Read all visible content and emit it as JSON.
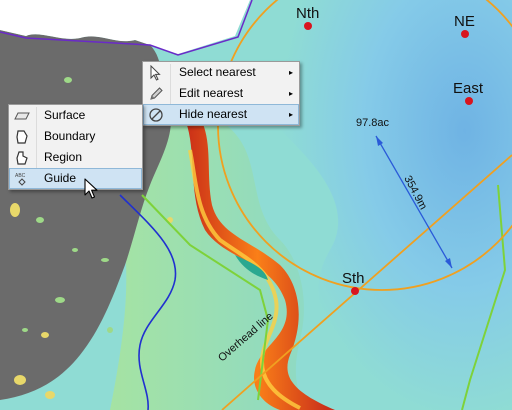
{
  "map": {
    "point_labels": [
      {
        "name": "nth",
        "text": "Nth"
      },
      {
        "name": "ne",
        "text": "NE"
      },
      {
        "name": "east",
        "text": "East"
      },
      {
        "name": "sth",
        "text": "Sth"
      }
    ],
    "area_label": "97.8ac",
    "distance_label": "354.9m",
    "line_label": "Overhead line"
  },
  "context_menu": {
    "items": [
      {
        "label": "Select nearest",
        "icon": "arrow-cursor-icon",
        "has_submenu": true
      },
      {
        "label": "Edit nearest",
        "icon": "pencil-icon",
        "has_submenu": true
      },
      {
        "label": "Hide nearest",
        "icon": "hide-circle-slash-icon",
        "has_submenu": true
      }
    ],
    "submenu_arrow": "▸"
  },
  "submenu": {
    "items": [
      {
        "label": "Surface",
        "icon": "surface-parallelogram-icon"
      },
      {
        "label": "Boundary",
        "icon": "boundary-polygon-icon"
      },
      {
        "label": "Region",
        "icon": "region-polygon-icon"
      },
      {
        "label": "Guide",
        "icon": "guide-abc-icon",
        "highlighted": true
      }
    ]
  },
  "colors": {
    "water_light": "#8fdcd4",
    "water_blue": "#7fc2e6",
    "land_gray": "#6e6e6e",
    "orange_circle": "#f0a020",
    "point_red": "#d8141e",
    "distance_blue": "#2a5ad8",
    "boundary_purple": "#6a2ac8",
    "guide_green": "#7ed23a",
    "menu_highlight": "#cfe3f3"
  }
}
